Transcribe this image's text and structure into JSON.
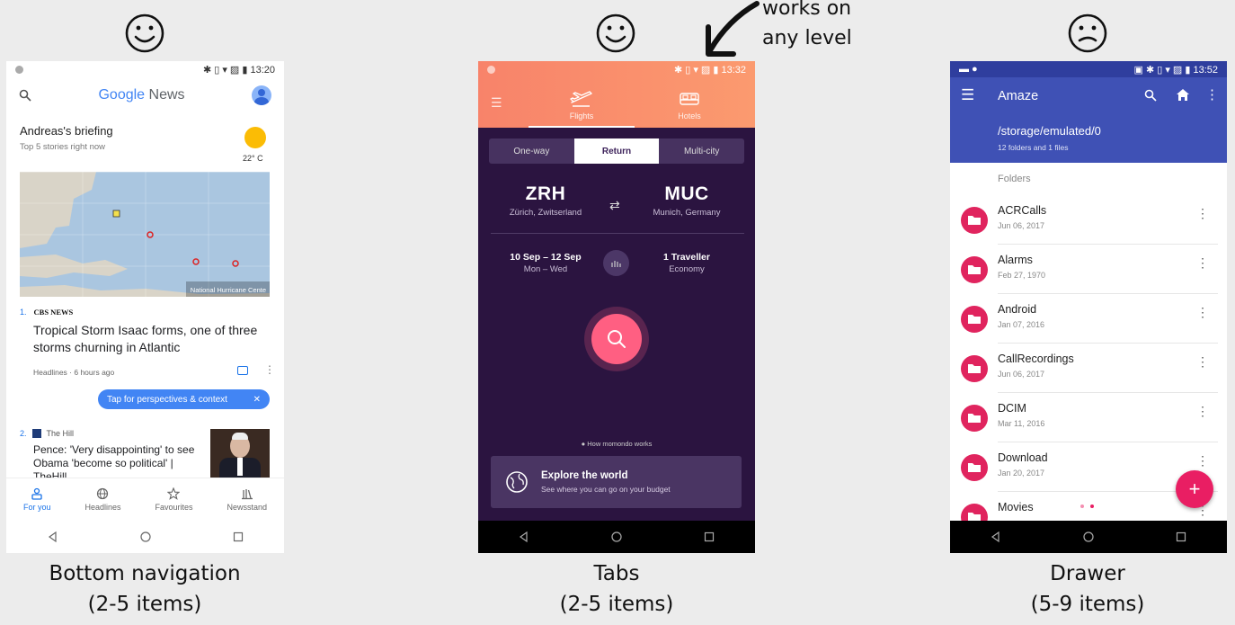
{
  "annotation": {
    "line1": "works on",
    "line2": "any level"
  },
  "panels": [
    {
      "caption_title": "Bottom navigation",
      "caption_sub": "(2-5 items)",
      "face": "happy-face-icon"
    },
    {
      "caption_title": "Tabs",
      "caption_sub": "(2-5 items)",
      "face": "happy-face-icon"
    },
    {
      "caption_title": "Drawer",
      "caption_sub": "(5-9 items)",
      "face": "confused-face-icon"
    }
  ],
  "google_news": {
    "time": "13:20",
    "logo_google": "Google",
    "logo_news": " News",
    "briefing_title": "Andreas's briefing",
    "briefing_sub": "Top 5 stories right now",
    "temperature": "22° C",
    "map_credit": "National Hurricane Cente",
    "story1": {
      "num": "1.",
      "source": "CBS NEWS",
      "headline": "Tropical Storm Isaac forms, one of three storms churning in Atlantic",
      "meta": "Headlines · 6 hours ago"
    },
    "tooltip": "Tap for perspectives & context",
    "story2": {
      "num": "2.",
      "source": "The Hill",
      "headline": "Pence: 'Very disappointing' to see Obama 'become so political' | TheHill"
    },
    "bottom_nav": [
      {
        "label": "For you",
        "icon": "for-you-icon"
      },
      {
        "label": "Headlines",
        "icon": "globe-icon"
      },
      {
        "label": "Favourites",
        "icon": "star-icon"
      },
      {
        "label": "Newsstand",
        "icon": "newsstand-icon"
      }
    ]
  },
  "momondo": {
    "time": "13:32",
    "tabs": [
      "Flights",
      "Hotels"
    ],
    "trip_types": [
      "One-way",
      "Return",
      "Multi-city"
    ],
    "selected_trip_type": "Return",
    "origin": {
      "code": "ZRH",
      "name": "Zürich, Zwitserland"
    },
    "destination": {
      "code": "MUC",
      "name": "Munich, Germany"
    },
    "dates": {
      "range": "10 Sep – 12 Sep",
      "days": "Mon – Wed"
    },
    "travellers": {
      "count": "1 Traveller",
      "cabin": "Economy"
    },
    "how_works": "How momondo works",
    "explore_title": "Explore the world",
    "explore_sub": "See where you can go on your budget"
  },
  "amaze": {
    "time": "13:52",
    "title": "Amaze",
    "path": "/storage/emulated/0",
    "summary": "12 folders and 1 files",
    "section": "Folders",
    "folders": [
      {
        "name": "ACRCalls",
        "date": "Jun 06, 2017"
      },
      {
        "name": "Alarms",
        "date": "Feb 27, 1970"
      },
      {
        "name": "Android",
        "date": "Jan 07, 2016"
      },
      {
        "name": "CallRecordings",
        "date": "Jun 06, 2017"
      },
      {
        "name": "DCIM",
        "date": "Mar 11, 2016"
      },
      {
        "name": "Download",
        "date": "Jan 20, 2017"
      },
      {
        "name": "Movies",
        "date": ""
      }
    ],
    "fab": "+",
    "accent": "#3f51b5",
    "folder_color": "#e0245e"
  }
}
